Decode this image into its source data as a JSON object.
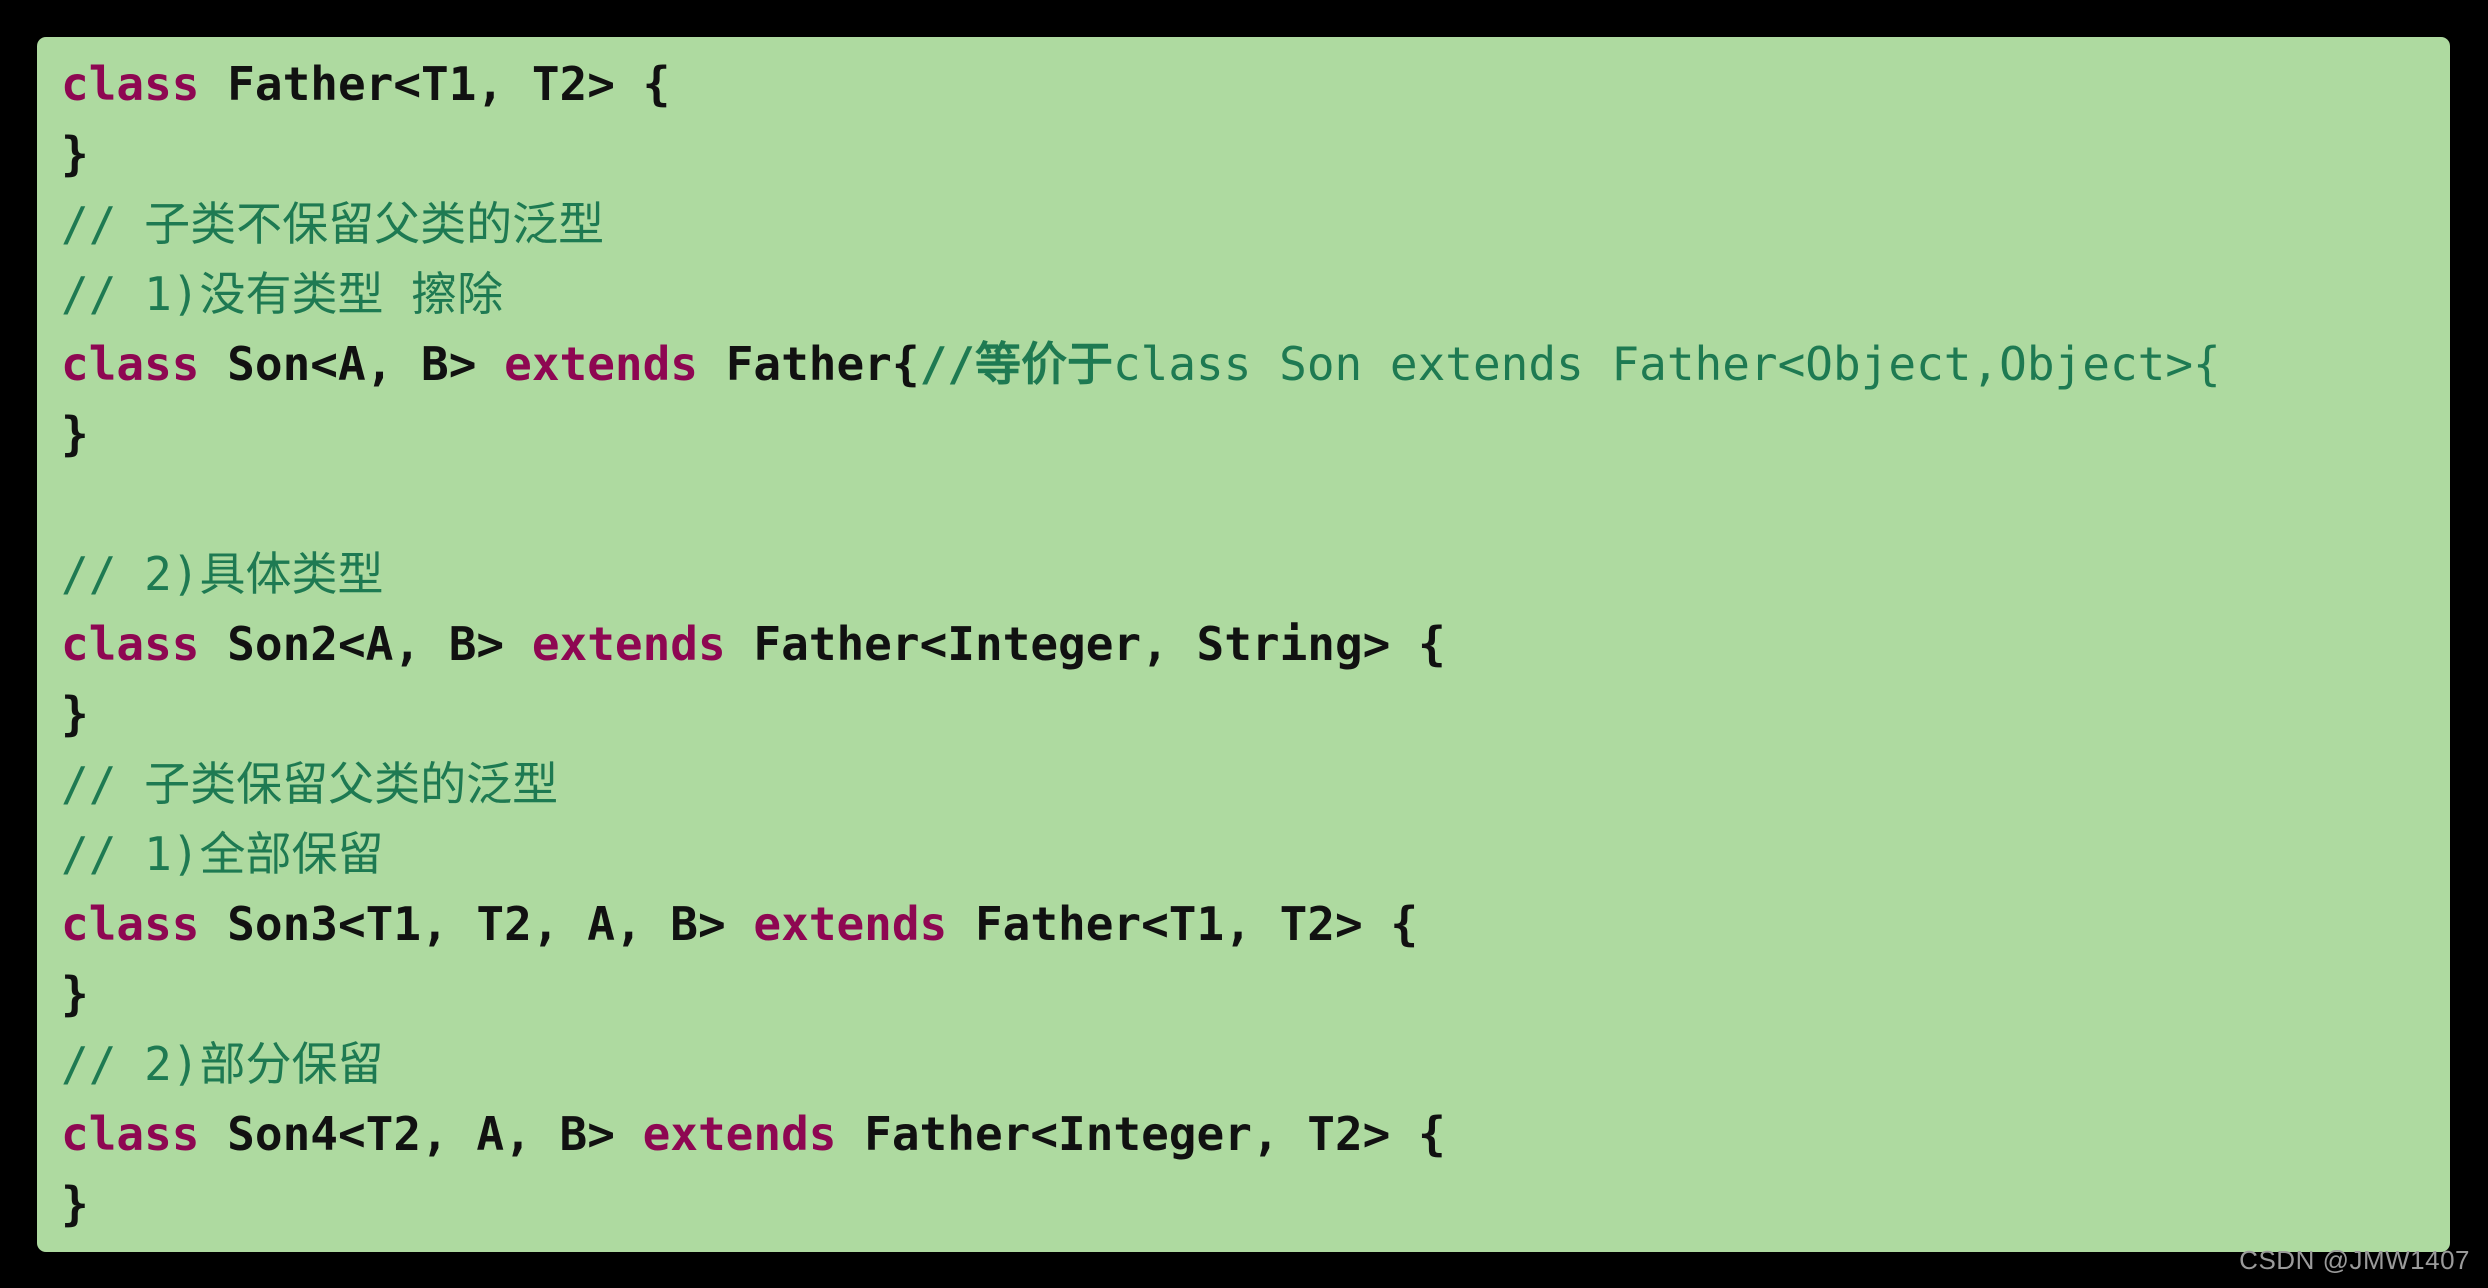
{
  "editor": {
    "language": "java",
    "background_color": "#aedaa0",
    "page_background_color": "#000000",
    "keyword_color": "#8e0752",
    "text_color": "#111111",
    "comment_color": "#1e7a52",
    "lines": [
      {
        "id": "line-1",
        "segments": [
          {
            "type": "keyword",
            "text": "class"
          },
          {
            "type": "plain",
            "text": " Father<T1, T2> {"
          }
        ]
      },
      {
        "id": "line-2",
        "segments": [
          {
            "type": "plain",
            "text": "}"
          }
        ]
      },
      {
        "id": "line-3",
        "segments": [
          {
            "type": "comment",
            "text": "// 子类不保留父类的泛型"
          }
        ]
      },
      {
        "id": "line-4",
        "segments": [
          {
            "type": "comment",
            "text": "// 1)没有类型 擦除"
          }
        ]
      },
      {
        "id": "line-5",
        "segments": [
          {
            "type": "keyword",
            "text": "class"
          },
          {
            "type": "plain",
            "text": " Son<A, B> "
          },
          {
            "type": "keyword",
            "text": "extends"
          },
          {
            "type": "plain",
            "text": " Father{"
          },
          {
            "type": "comment-bold",
            "text": "//等价于"
          },
          {
            "type": "comment",
            "text": "class Son extends Father<Object,Object>{"
          }
        ]
      },
      {
        "id": "line-6",
        "segments": [
          {
            "type": "plain",
            "text": "}"
          }
        ]
      },
      {
        "id": "line-7",
        "segments": [
          {
            "type": "plain",
            "text": ""
          }
        ]
      },
      {
        "id": "line-8",
        "segments": [
          {
            "type": "comment",
            "text": "// 2)具体类型"
          }
        ]
      },
      {
        "id": "line-9",
        "segments": [
          {
            "type": "keyword",
            "text": "class"
          },
          {
            "type": "plain",
            "text": " Son2<A, B> "
          },
          {
            "type": "keyword",
            "text": "extends"
          },
          {
            "type": "plain",
            "text": " Father<Integer, String> {"
          }
        ]
      },
      {
        "id": "line-10",
        "segments": [
          {
            "type": "plain",
            "text": "}"
          }
        ]
      },
      {
        "id": "line-11",
        "segments": [
          {
            "type": "comment",
            "text": "// 子类保留父类的泛型"
          }
        ]
      },
      {
        "id": "line-12",
        "segments": [
          {
            "type": "comment",
            "text": "// 1)全部保留"
          }
        ]
      },
      {
        "id": "line-13",
        "segments": [
          {
            "type": "keyword",
            "text": "class"
          },
          {
            "type": "plain",
            "text": " Son3<T1, T2, A, B> "
          },
          {
            "type": "keyword",
            "text": "extends"
          },
          {
            "type": "plain",
            "text": " Father<T1, T2> {"
          }
        ]
      },
      {
        "id": "line-14",
        "segments": [
          {
            "type": "plain",
            "text": "}"
          }
        ]
      },
      {
        "id": "line-15",
        "segments": [
          {
            "type": "comment",
            "text": "// 2)部分保留"
          }
        ]
      },
      {
        "id": "line-16",
        "segments": [
          {
            "type": "keyword",
            "text": "class"
          },
          {
            "type": "plain",
            "text": " Son4<T2, A, B> "
          },
          {
            "type": "keyword",
            "text": "extends"
          },
          {
            "type": "plain",
            "text": " Father<Integer, T2> {"
          }
        ]
      },
      {
        "id": "line-17",
        "segments": [
          {
            "type": "plain",
            "text": "}"
          }
        ]
      }
    ]
  },
  "watermark": {
    "text": "CSDN @JMW1407"
  }
}
